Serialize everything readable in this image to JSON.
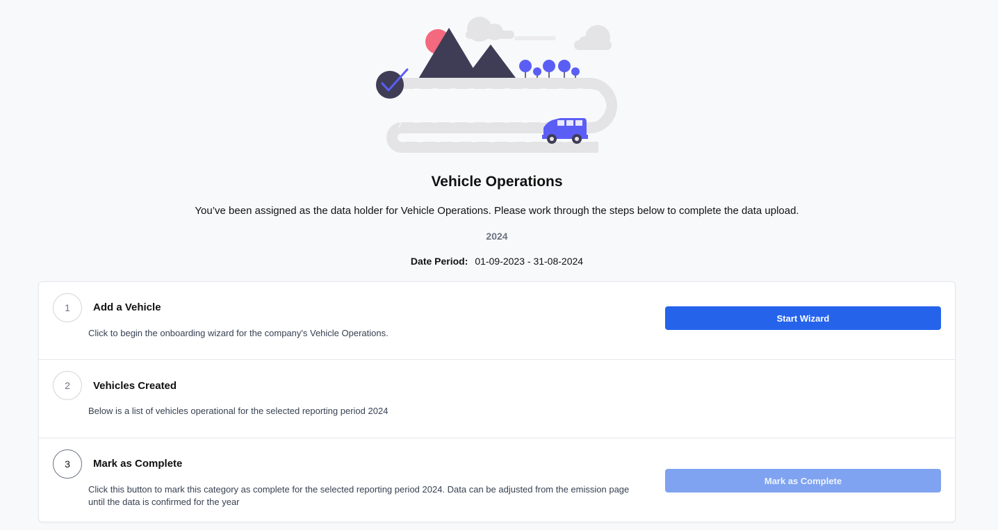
{
  "header": {
    "title": "Vehicle Operations",
    "intro": "You’ve been assigned as the data holder for Vehicle Operations. Please work through the steps below to complete the data upload.",
    "year": "2024",
    "date_period_label": "Date Period:",
    "date_period_value": "01-09-2023 - 31-08-2024"
  },
  "steps": [
    {
      "number": "1",
      "title": "Add a Vehicle",
      "description": "Click to begin the onboarding wizard for the company's Vehicle Operations.",
      "button_label": "Start Wizard"
    },
    {
      "number": "2",
      "title": "Vehicles Created",
      "description": "Below is a list of vehicles operational for the selected reporting period 2024"
    },
    {
      "number": "3",
      "title": "Mark as Complete",
      "description": "Click this button to mark this category as complete for the selected reporting period 2024. Data can be adjusted from the emission page until the data is confirmed for the year",
      "button_label": "Mark as Complete"
    }
  ],
  "colors": {
    "accent": "#2563eb",
    "accent_disabled": "#7fa3f0",
    "illustration_purple": "#5b5ef5",
    "illustration_dark": "#3f3d56",
    "illustration_sun": "#f4697e"
  },
  "illustration": {
    "icon": "road-trip-illustration"
  }
}
